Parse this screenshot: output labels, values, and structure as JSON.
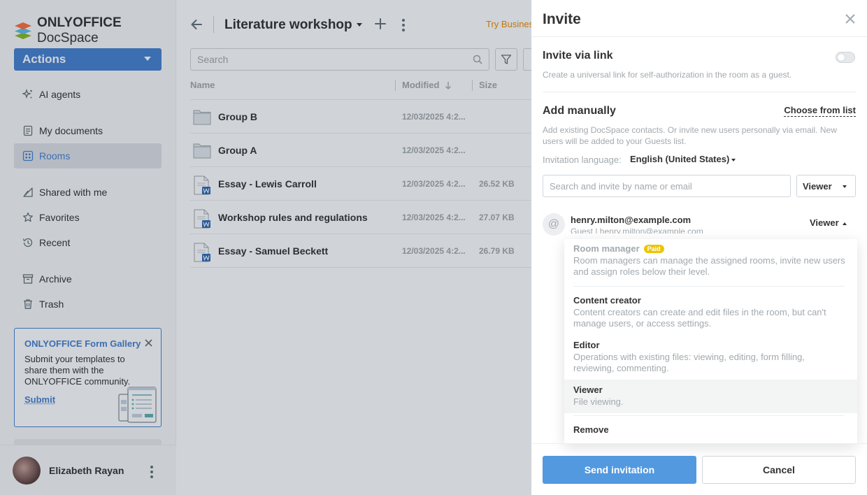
{
  "app": {
    "brand_bold": "ONLYOFFICE",
    "brand_light": "DocSpace"
  },
  "sidebar": {
    "actions_label": "Actions",
    "items": [
      {
        "label": "AI agents",
        "icon": "sparkle-icon"
      },
      {
        "label": "My documents",
        "icon": "document-icon"
      },
      {
        "label": "Rooms",
        "icon": "rooms-icon",
        "active": true
      },
      {
        "label": "Shared with me",
        "icon": "shared-icon"
      },
      {
        "label": "Favorites",
        "icon": "star-icon"
      },
      {
        "label": "Recent",
        "icon": "recent-icon"
      },
      {
        "label": "Archive",
        "icon": "archive-icon"
      },
      {
        "label": "Trash",
        "icon": "trash-icon"
      }
    ],
    "promo": {
      "title": "ONLYOFFICE Form Gallery",
      "text": "Submit your templates to share them with the ONLYOFFICE community.",
      "link": "Submit"
    },
    "profile": {
      "name": "Elizabeth Rayan"
    }
  },
  "header": {
    "title": "Literature workshop",
    "try_business": "Try Business"
  },
  "search": {
    "placeholder": "Search"
  },
  "table": {
    "columns": {
      "name": "Name",
      "modified": "Modified",
      "size": "Size"
    },
    "rows": [
      {
        "name": "Group B",
        "modified": "12/03/2025 4:2...",
        "size": "",
        "type": "folder"
      },
      {
        "name": "Group A",
        "modified": "12/03/2025 4:2...",
        "size": "",
        "type": "folder"
      },
      {
        "name": "Essay - Lewis Carroll",
        "modified": "12/03/2025 4:2...",
        "size": "26.52 KB",
        "type": "docx"
      },
      {
        "name": "Workshop rules and regulations",
        "modified": "12/03/2025 4:2...",
        "size": "27.07 KB",
        "type": "docx"
      },
      {
        "name": "Essay - Samuel Beckett",
        "modified": "12/03/2025 4:2...",
        "size": "26.79 KB",
        "type": "docx"
      }
    ]
  },
  "invite": {
    "title": "Invite",
    "via_link_title": "Invite via link",
    "via_link_desc": "Create a universal link for self-authorization in the room as a guest.",
    "via_link_enabled": false,
    "add_manually_title": "Add manually",
    "choose_from_list": "Choose from list",
    "add_manually_desc": "Add existing DocSpace contacts. Or invite new users personally via email. New users will be added to your Guests list.",
    "language_label": "Invitation language:",
    "language_value": "English (United States)",
    "input_placeholder": "Search and invite by name or email",
    "default_role": "Viewer",
    "invitee": {
      "avatar": "@",
      "email": "henry.milton@example.com",
      "sub": "Guest | henry.milton@example.com",
      "role": "Viewer"
    },
    "roles": [
      {
        "title": "Room manager",
        "badge": "Paid",
        "desc": "Room managers can manage the assigned rooms, invite new users and assign roles below their level."
      },
      {
        "title": "Content creator",
        "desc": "Content creators can create and edit files in the room, but can't manage users, or access settings."
      },
      {
        "title": "Editor",
        "desc": "Operations with existing files: viewing, editing, form filling, reviewing, commenting."
      },
      {
        "title": "Viewer",
        "desc": "File viewing.",
        "selected": true
      },
      {
        "title": "Remove"
      }
    ],
    "send_label": "Send invitation",
    "cancel_label": "Cancel"
  },
  "colors": {
    "accent": "#4781d1",
    "send": "#5299e0",
    "paid_badge": "#edc409",
    "try_business": "#ef8b00"
  }
}
